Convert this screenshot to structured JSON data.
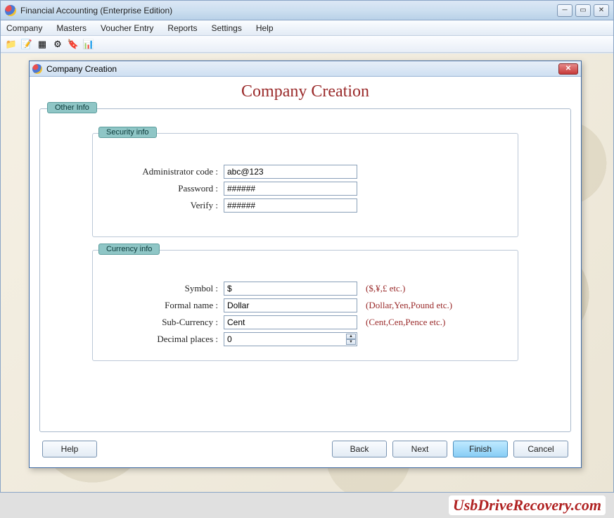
{
  "app": {
    "title": "Financial Accounting (Enterprise Edition)"
  },
  "menubar": {
    "items": [
      "Company",
      "Masters",
      "Voucher Entry",
      "Reports",
      "Settings",
      "Help"
    ]
  },
  "dialog": {
    "title": "Company Creation",
    "heading": "Company Creation",
    "outer_group": "Other Info",
    "security_group": "Security info",
    "currency_group": "Currency info",
    "fields": {
      "admin_code": {
        "label": "Administrator code :",
        "value": "abc@123"
      },
      "password": {
        "label": "Password :",
        "value": "######"
      },
      "verify": {
        "label": "Verify :",
        "value": "######"
      },
      "symbol": {
        "label": "Symbol :",
        "value": "$",
        "hint": "($,¥,£ etc.)"
      },
      "formal_name": {
        "label": "Formal name :",
        "value": "Dollar",
        "hint": "(Dollar,Yen,Pound etc.)"
      },
      "sub_currency": {
        "label": "Sub-Currency :",
        "value": "Cent",
        "hint": "(Cent,Cen,Pence etc.)"
      },
      "decimal_places": {
        "label": "Decimal places :",
        "value": "0"
      }
    },
    "buttons": {
      "help": "Help",
      "back": "Back",
      "next": "Next",
      "finish": "Finish",
      "cancel": "Cancel"
    }
  },
  "watermark": "UsbDriveRecovery.com"
}
